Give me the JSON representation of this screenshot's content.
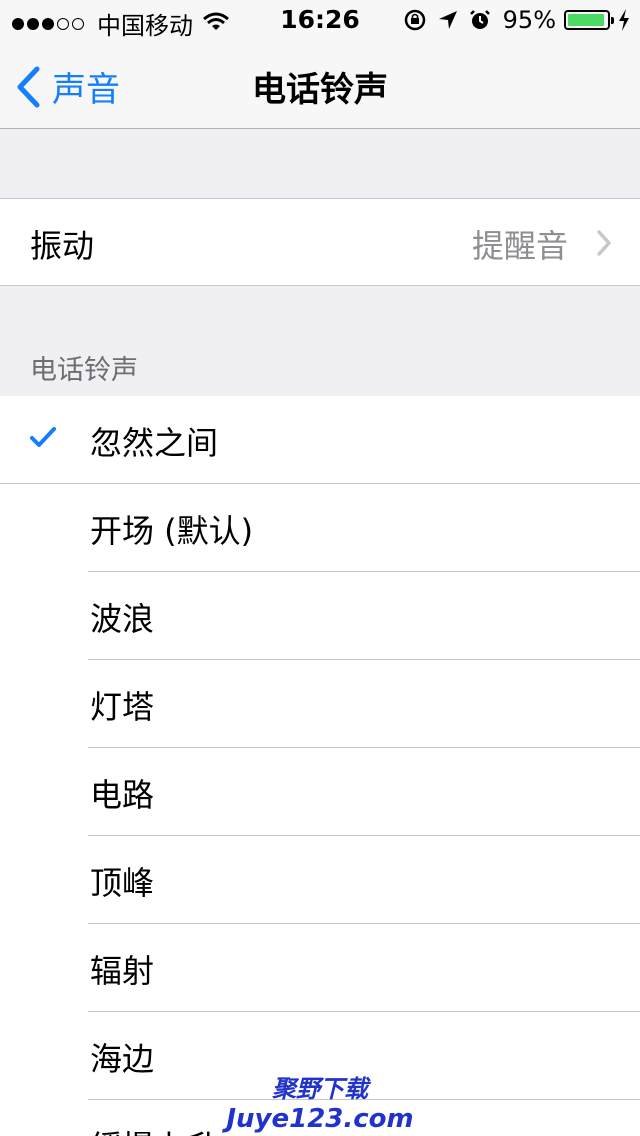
{
  "status_bar": {
    "signal_bars": 3,
    "signal_total": 5,
    "carrier": "中国移动",
    "time": "16:26",
    "battery_percent": "95%",
    "battery_level": 0.95,
    "icons": [
      "wifi-icon",
      "rotation-lock-icon",
      "location-arrow-icon",
      "alarm-icon",
      "charging-bolt-icon"
    ]
  },
  "nav": {
    "back_label": "声音",
    "title": "电话铃声"
  },
  "vibration": {
    "label": "振动",
    "value": "提醒音"
  },
  "section": {
    "header": "电话铃声",
    "selected_index": 0,
    "items": [
      {
        "label": "忽然之间"
      },
      {
        "label": "开场 (默认)"
      },
      {
        "label": "波浪"
      },
      {
        "label": "灯塔"
      },
      {
        "label": "电路"
      },
      {
        "label": "顶峰"
      },
      {
        "label": "辐射"
      },
      {
        "label": "海边"
      },
      {
        "label": "缓慢上升"
      }
    ]
  },
  "watermark": {
    "line1": "聚野下载",
    "line2": "Juye123.com"
  },
  "colors": {
    "accent": "#157efb",
    "background": "#efeff4",
    "battery_fill": "#4cd964",
    "secondary_text": "#8e8e93"
  }
}
